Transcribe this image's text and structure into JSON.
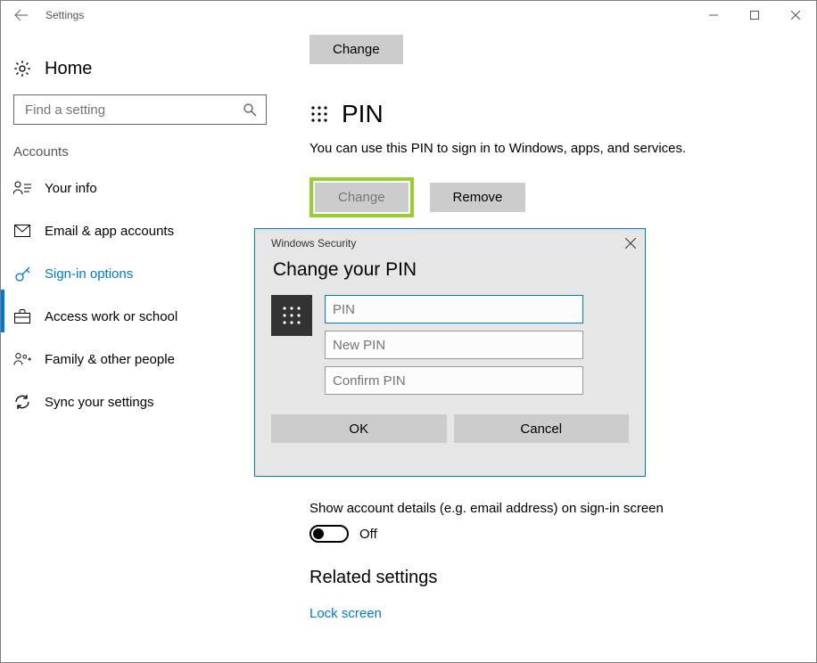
{
  "titlebar": {
    "title": "Settings"
  },
  "sidebar": {
    "home": "Home",
    "search_placeholder": "Find a setting",
    "category": "Accounts",
    "items": [
      {
        "label": "Your info",
        "active": false
      },
      {
        "label": "Email & app accounts",
        "active": false
      },
      {
        "label": "Sign-in options",
        "active": true
      },
      {
        "label": "Access work or school",
        "active": false
      },
      {
        "label": "Family & other people",
        "active": false
      },
      {
        "label": "Sync your settings",
        "active": false
      }
    ]
  },
  "main": {
    "top_change": "Change",
    "pin_heading": "PIN",
    "pin_desc": "You can use this PIN to sign in to Windows, apps, and services.",
    "change_btn": "Change",
    "remove_btn": "Remove",
    "show_details_label": "Show account details (e.g. email address) on sign-in screen",
    "toggle_state": "Off",
    "related_heading": "Related settings",
    "lock_screen_link": "Lock screen"
  },
  "dialog": {
    "win_title": "Windows Security",
    "heading": "Change your PIN",
    "pin_ph": "PIN",
    "newpin_ph": "New PIN",
    "confirm_ph": "Confirm PIN",
    "ok": "OK",
    "cancel": "Cancel"
  }
}
